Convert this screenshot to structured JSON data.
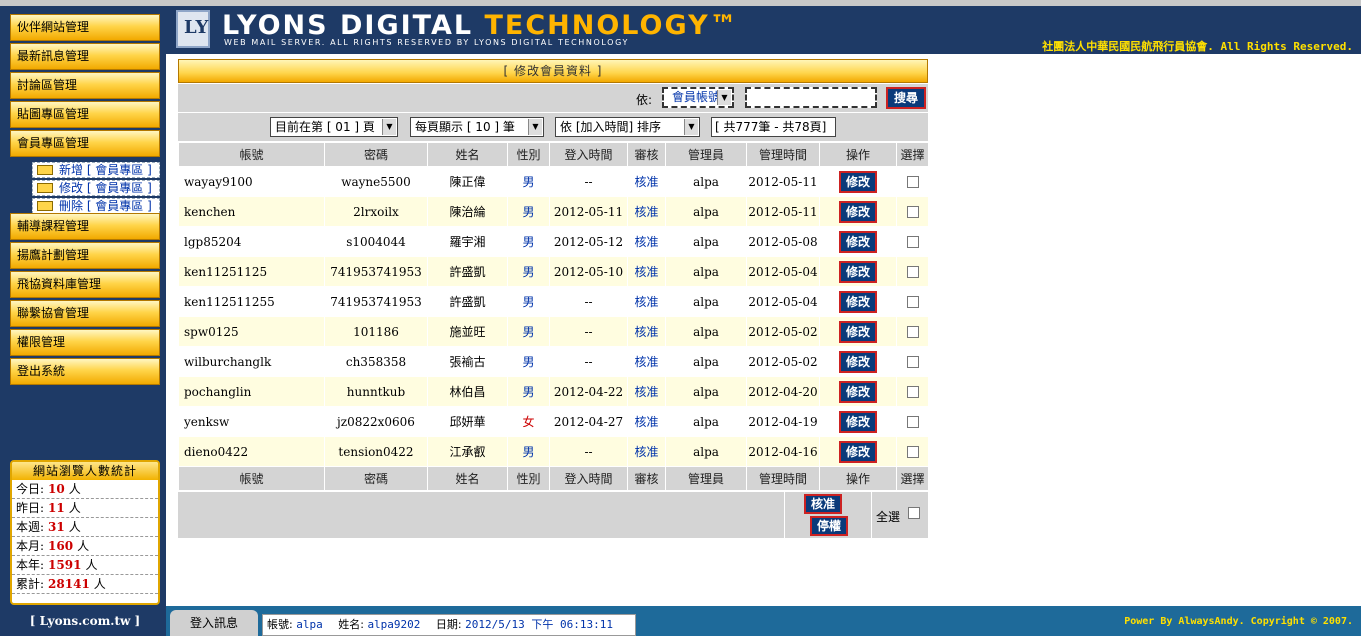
{
  "header": {
    "brand_main": "LYONS DIGITAL",
    "brand_accent": "TECHNOLOGY™",
    "brand_sub": "WEB MAIL SERVER. ALL RIGHTS RESERVED BY LYONS DIGITAL TECHNOLOGY",
    "org": "社團法人中華民國民航飛行員協會. All Rights Reserved."
  },
  "sidebar": {
    "items": [
      {
        "label": "伙伴網站管理"
      },
      {
        "label": "最新訊息管理"
      },
      {
        "label": "討論區管理"
      },
      {
        "label": "貼圖專區管理"
      },
      {
        "label": "會員專區管理"
      },
      {
        "label": "輔導課程管理"
      },
      {
        "label": "揚鷹計劃管理"
      },
      {
        "label": "飛協資料庫管理"
      },
      {
        "label": "聯繫協會管理"
      },
      {
        "label": "權限管理"
      },
      {
        "label": "登出系統"
      }
    ],
    "submenu": [
      {
        "label": "新增 [ 會員專區 ]"
      },
      {
        "label": "修改 [ 會員專區 ]"
      },
      {
        "label": "刪除 [ 會員專區 ]"
      }
    ]
  },
  "stats": {
    "title": "網站瀏覽人數統計",
    "rows": [
      {
        "label": "今日:",
        "value": "10",
        "unit": "人"
      },
      {
        "label": "昨日:",
        "value": "11",
        "unit": "人"
      },
      {
        "label": "本週:",
        "value": "31",
        "unit": "人"
      },
      {
        "label": "本月:",
        "value": "160",
        "unit": "人"
      },
      {
        "label": "本年:",
        "value": "1591",
        "unit": "人"
      },
      {
        "label": "累計:",
        "value": "28141",
        "unit": "人"
      }
    ]
  },
  "site_link": "[ Lyons.com.tw ]",
  "panel_title": "[ 修改會員資料 ]",
  "search": {
    "label": "依:",
    "field_value": "會員帳號",
    "button": "搜尋"
  },
  "pager": {
    "page_select": "目前在第 [ 01 ] 頁",
    "per_page_select": "每頁顯示 [ 10 ] 筆",
    "sort_select": "依 [加入時間] 排序",
    "total": "[ 共777筆 - 共78頁]"
  },
  "table": {
    "headers": [
      "帳號",
      "密碼",
      "姓名",
      "性別",
      "登入時間",
      "審核",
      "管理員",
      "管理時間",
      "操作",
      "選擇"
    ],
    "edit_label": "修改",
    "rows": [
      {
        "account": "wayay9100",
        "password": "wayne5500",
        "name": "陳正偉",
        "gender": "男",
        "login": "--",
        "status": "核准",
        "admin": "alpa",
        "time": "2012-05-11"
      },
      {
        "account": "kenchen",
        "password": "2lrxoilx",
        "name": "陳治綸",
        "gender": "男",
        "login": "2012-05-11",
        "status": "核准",
        "admin": "alpa",
        "time": "2012-05-11"
      },
      {
        "account": "lgp85204",
        "password": "s1004044",
        "name": "羅宇湘",
        "gender": "男",
        "login": "2012-05-12",
        "status": "核准",
        "admin": "alpa",
        "time": "2012-05-08"
      },
      {
        "account": "ken11251125",
        "password": "741953741953",
        "name": "許盛凱",
        "gender": "男",
        "login": "2012-05-10",
        "status": "核准",
        "admin": "alpa",
        "time": "2012-05-04"
      },
      {
        "account": "ken112511255",
        "password": "741953741953",
        "name": "許盛凱",
        "gender": "男",
        "login": "--",
        "status": "核准",
        "admin": "alpa",
        "time": "2012-05-04"
      },
      {
        "account": "spw0125",
        "password": "101186",
        "name": "施並旺",
        "gender": "男",
        "login": "--",
        "status": "核准",
        "admin": "alpa",
        "time": "2012-05-02"
      },
      {
        "account": "wilburchanglk",
        "password": "ch358358",
        "name": "張褕古",
        "gender": "男",
        "login": "--",
        "status": "核准",
        "admin": "alpa",
        "time": "2012-05-02"
      },
      {
        "account": "pochanglin",
        "password": "hunntkub",
        "name": "林伯昌",
        "gender": "男",
        "login": "2012-04-22",
        "status": "核准",
        "admin": "alpa",
        "time": "2012-04-20"
      },
      {
        "account": "yenksw",
        "password": "jz0822x0606",
        "name": "邱妍華",
        "gender": "女",
        "login": "2012-04-27",
        "status": "核准",
        "admin": "alpa",
        "time": "2012-04-19"
      },
      {
        "account": "dieno0422",
        "password": "tension0422",
        "name": "江承叡",
        "gender": "男",
        "login": "--",
        "status": "核准",
        "admin": "alpa",
        "time": "2012-04-16"
      }
    ]
  },
  "actions": {
    "approve": "核准",
    "suspend": "停權",
    "select_all": "全選"
  },
  "statusbar": {
    "tab": "登入訊息",
    "account_label": "帳號:",
    "account_value": "alpa",
    "name_label": "姓名:",
    "name_value": "alpa9202",
    "date_label": "日期:",
    "date_value": "2012/5/13 下午 06:13:11",
    "powered": "Power By AlwaysAndy. Copyright © 2007."
  }
}
